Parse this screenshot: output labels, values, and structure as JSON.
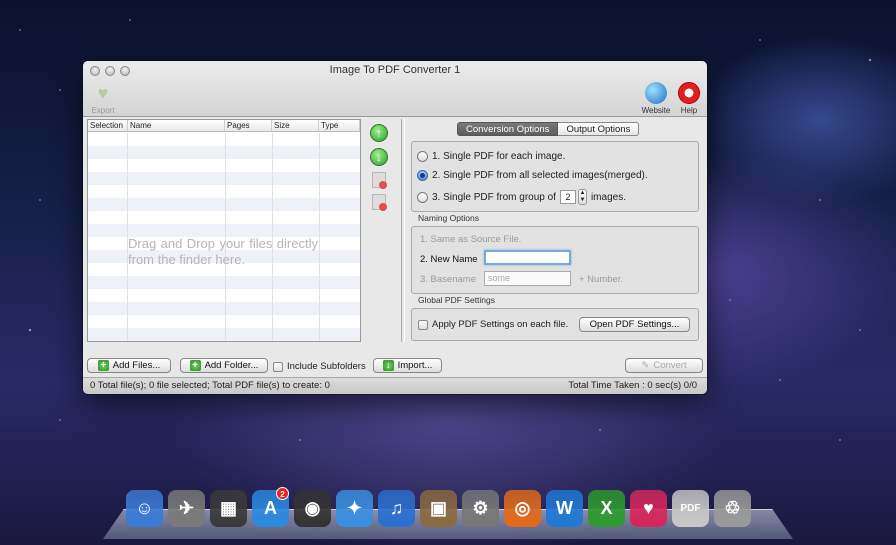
{
  "window": {
    "title": "Image To PDF Converter 1"
  },
  "toolbar": {
    "export_label": "Export",
    "website_label": "Website",
    "help_label": "Help"
  },
  "file_table": {
    "columns": [
      "Selection",
      "Name",
      "Pages",
      "Size",
      "Type"
    ],
    "drop_hint": "Drag and Drop your files directly from the finder here."
  },
  "tabs": [
    "Conversion Options",
    "Output Options"
  ],
  "conversion_options": {
    "option1": "1. Single PDF for each image.",
    "option2": "2. Single PDF from all selected images(merged).",
    "option3_prefix": "3. Single PDF from group of",
    "option3_value": "2",
    "option3_suffix": "images.",
    "selected": 2
  },
  "naming_options": {
    "title": "Naming Options",
    "same_as_source": "1. Same as Source File.",
    "new_name": "2. New Name",
    "new_name_value": "",
    "basename": "3. Basename",
    "basename_placeholder": "some",
    "plus_number": "+ Number."
  },
  "global_settings": {
    "title": "Global PDF Settings",
    "apply_label": "Apply PDF Settings on each file.",
    "open_button": "Open PDF Settings..."
  },
  "bottom_buttons": {
    "add_files": "Add Files...",
    "add_folder": "Add Folder...",
    "include_subfolders": "Include Subfolders",
    "import": "Import...",
    "convert": "Convert"
  },
  "status": {
    "left": "0 Total file(s); 0 file selected; Total PDF file(s) to create: 0",
    "right": "Total Time Taken : 0 sec(s) 0/0"
  },
  "dock": {
    "items": [
      {
        "name": "finder-icon",
        "glyph": "☺",
        "color": "#3a7bd5"
      },
      {
        "name": "launchpad-icon",
        "glyph": "✈",
        "color": "#7a7a7a"
      },
      {
        "name": "mission-control-icon",
        "glyph": "▦",
        "color": "#3a3a3a"
      },
      {
        "name": "app-store-icon",
        "glyph": "A",
        "color": "#2a8ae0",
        "badge": "2"
      },
      {
        "name": "dashboard-icon",
        "glyph": "◉",
        "color": "#333333"
      },
      {
        "name": "safari-icon",
        "glyph": "✦",
        "color": "#3b8fe0"
      },
      {
        "name": "itunes-icon",
        "glyph": "♫",
        "color": "#2a70d0"
      },
      {
        "name": "iphoto-icon",
        "glyph": "▣",
        "color": "#8a6a40"
      },
      {
        "name": "system-preferences-icon",
        "glyph": "⚙",
        "color": "#777777"
      },
      {
        "name": "firefox-icon",
        "glyph": "◎",
        "color": "#e26a1a"
      },
      {
        "name": "word-icon",
        "glyph": "W",
        "color": "#1f79d6"
      },
      {
        "name": "excel-icon",
        "glyph": "X",
        "color": "#2e9a2e"
      },
      {
        "name": "heart-app-icon",
        "glyph": "♥",
        "color": "#d8265a"
      },
      {
        "name": "pdf-app-icon",
        "glyph": "PDF",
        "color": "#c8c8c8"
      },
      {
        "name": "trash-icon",
        "glyph": "♲",
        "color": "#9a9a9a"
      }
    ]
  }
}
